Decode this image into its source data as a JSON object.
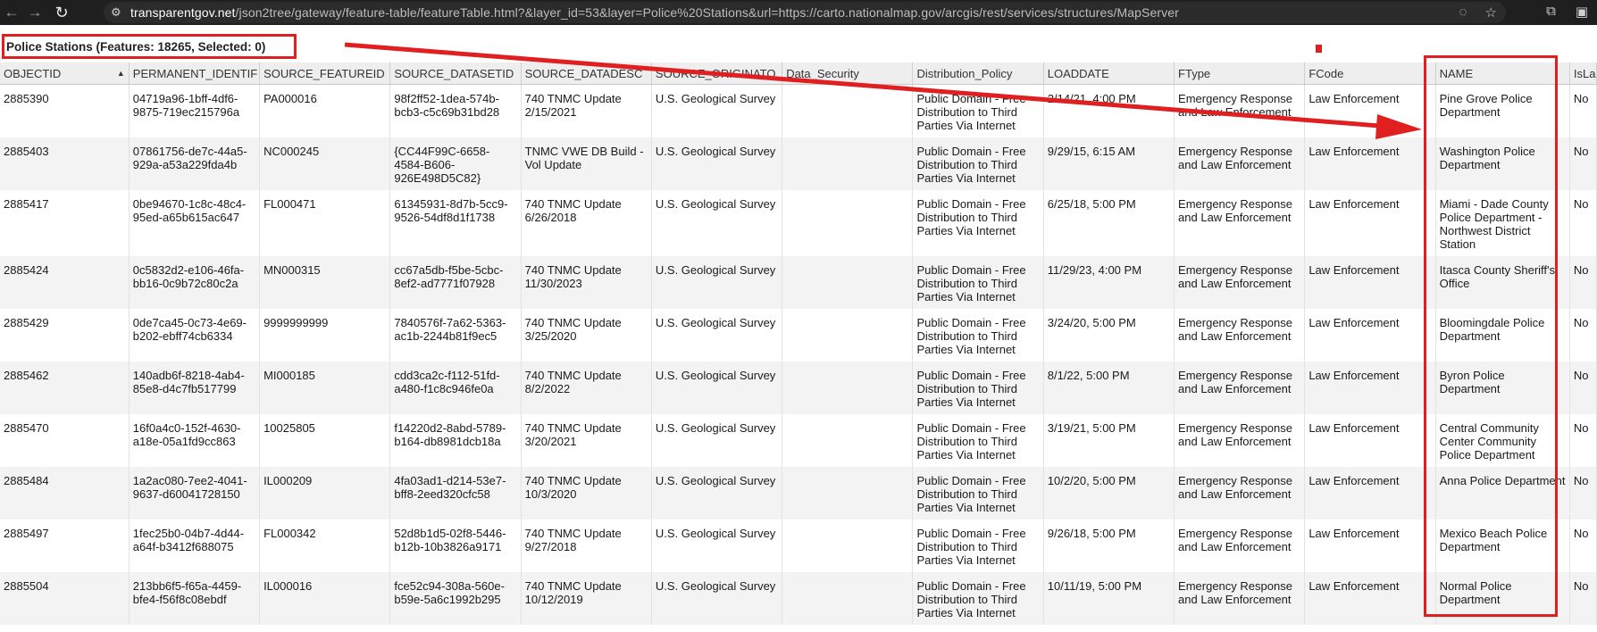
{
  "browser": {
    "url_host": "transparentgov.net",
    "url_path": "/json2tree/gateway/feature-table/featureTable.html?&layer_id=53&layer=Police%20Stations&url=https://carto.nationalmap.gov/arcgis/rest/services/structures/MapServer",
    "icons": [
      "back-arrow-icon",
      "forward-arrow-icon",
      "reload-icon",
      "site-info-icon",
      "eye-off-icon",
      "star-icon",
      "extensions-icon",
      "sidebar-icon"
    ]
  },
  "page": {
    "title": "Police Stations (Features: 18265, Selected: 0)"
  },
  "annotation": {
    "color": "#e02020"
  },
  "table": {
    "columns": [
      "OBJECTID",
      "PERMANENT_IDENTIF",
      "SOURCE_FEATUREID",
      "SOURCE_DATASETID",
      "SOURCE_DATADESC",
      "SOURCE_ORIGINATO",
      "Data_Security",
      "Distribution_Policy",
      "LOADDATE",
      "FType",
      "FCode",
      "NAME",
      "IsLar"
    ],
    "rows": [
      [
        "2885390",
        "04719a96-1bff-4df6-9875-719ec215796a",
        "PA000016",
        "98f2ff52-1dea-574b-bcb3-c5c69b31bd28",
        "740 TNMC Update 2/15/2021",
        "U.S. Geological Survey",
        "",
        "Public Domain - Free Distribution to Third Parties Via Internet",
        "2/14/21, 4:00 PM",
        "Emergency Response and Law Enforcement",
        "Law Enforcement",
        "Pine Grove Police Department",
        "No"
      ],
      [
        "2885403",
        "07861756-de7c-44a5-929a-a53a229fda4b",
        "NC000245",
        "{CC44F99C-6658-4584-B606-926E498D5C82}",
        "TNMC VWE DB Build - Vol Update",
        "U.S. Geological Survey",
        "",
        "Public Domain - Free Distribution to Third Parties Via Internet",
        "9/29/15, 6:15 AM",
        "Emergency Response and Law Enforcement",
        "Law Enforcement",
        "Washington Police Department",
        "No"
      ],
      [
        "2885417",
        "0be94670-1c8c-48c4-95ed-a65b615ac647",
        "FL000471",
        "61345931-8d7b-5cc9-9526-54df8d1f1738",
        "740 TNMC Update 6/26/2018",
        "U.S. Geological Survey",
        "",
        "Public Domain - Free Distribution to Third Parties Via Internet",
        "6/25/18, 5:00 PM",
        "Emergency Response and Law Enforcement",
        "Law Enforcement",
        "Miami - Dade County Police Department - Northwest District Station",
        "No"
      ],
      [
        "2885424",
        "0c5832d2-e106-46fa-bb16-0c9b72c80c2a",
        "MN000315",
        "cc67a5db-f5be-5cbc-8ef2-ad7771f07928",
        "740 TNMC Update 11/30/2023",
        "U.S. Geological Survey",
        "",
        "Public Domain - Free Distribution to Third Parties Via Internet",
        "11/29/23, 4:00 PM",
        "Emergency Response and Law Enforcement",
        "Law Enforcement",
        "Itasca County Sheriff's Office",
        "No"
      ],
      [
        "2885429",
        "0de7ca45-0c73-4e69-b202-ebff74cb6334",
        "9999999999",
        "7840576f-7a62-5363-ac1b-2244b81f9ec5",
        "740 TNMC Update 3/25/2020",
        "U.S. Geological Survey",
        "",
        "Public Domain - Free Distribution to Third Parties Via Internet",
        "3/24/20, 5:00 PM",
        "Emergency Response and Law Enforcement",
        "Law Enforcement",
        "Bloomingdale Police Department",
        "No"
      ],
      [
        "2885462",
        "140adb6f-8218-4ab4-85e8-d4c7fb517799",
        "MI000185",
        "cdd3ca2c-f112-51fd-a480-f1c8c946fe0a",
        "740 TNMC Update 8/2/2022",
        "U.S. Geological Survey",
        "",
        "Public Domain - Free Distribution to Third Parties Via Internet",
        "8/1/22, 5:00 PM",
        "Emergency Response and Law Enforcement",
        "Law Enforcement",
        "Byron Police Department",
        "No"
      ],
      [
        "2885470",
        "16f0a4c0-152f-4630-a18e-05a1fd9cc863",
        "10025805",
        "f14220d2-8abd-5789-b164-db8981dcb18a",
        "740 TNMC Update 3/20/2021",
        "U.S. Geological Survey",
        "",
        "Public Domain - Free Distribution to Third Parties Via Internet",
        "3/19/21, 5:00 PM",
        "Emergency Response and Law Enforcement",
        "Law Enforcement",
        "Central Community Center Community Police Department",
        "No"
      ],
      [
        "2885484",
        "1a2ac080-7ee2-4041-9637-d60041728150",
        "IL000209",
        "4fa03ad1-d214-53e7-bff8-2eed320cfc58",
        "740 TNMC Update 10/3/2020",
        "U.S. Geological Survey",
        "",
        "Public Domain - Free Distribution to Third Parties Via Internet",
        "10/2/20, 5:00 PM",
        "Emergency Response and Law Enforcement",
        "Law Enforcement",
        "Anna Police Department",
        "No"
      ],
      [
        "2885497",
        "1fec25b0-04b7-4d44-a64f-b3412f688075",
        "FL000342",
        "52d8b1d5-02f8-5446-b12b-10b3826a9171",
        "740 TNMC Update 9/27/2018",
        "U.S. Geological Survey",
        "",
        "Public Domain - Free Distribution to Third Parties Via Internet",
        "9/26/18, 5:00 PM",
        "Emergency Response and Law Enforcement",
        "Law Enforcement",
        "Mexico Beach Police Department",
        "No"
      ],
      [
        "2885504",
        "213bb6f5-f65a-4459-bfe4-f56f8c08ebdf",
        "IL000016",
        "fce52c94-308a-560e-b59e-5a6c1992b295",
        "740 TNMC Update 10/12/2019",
        "U.S. Geological Survey",
        "",
        "Public Domain - Free Distribution to Third Parties Via Internet",
        "10/11/19, 5:00 PM",
        "Emergency Response and Law Enforcement",
        "Law Enforcement",
        "Normal Police Department",
        "No"
      ]
    ]
  }
}
